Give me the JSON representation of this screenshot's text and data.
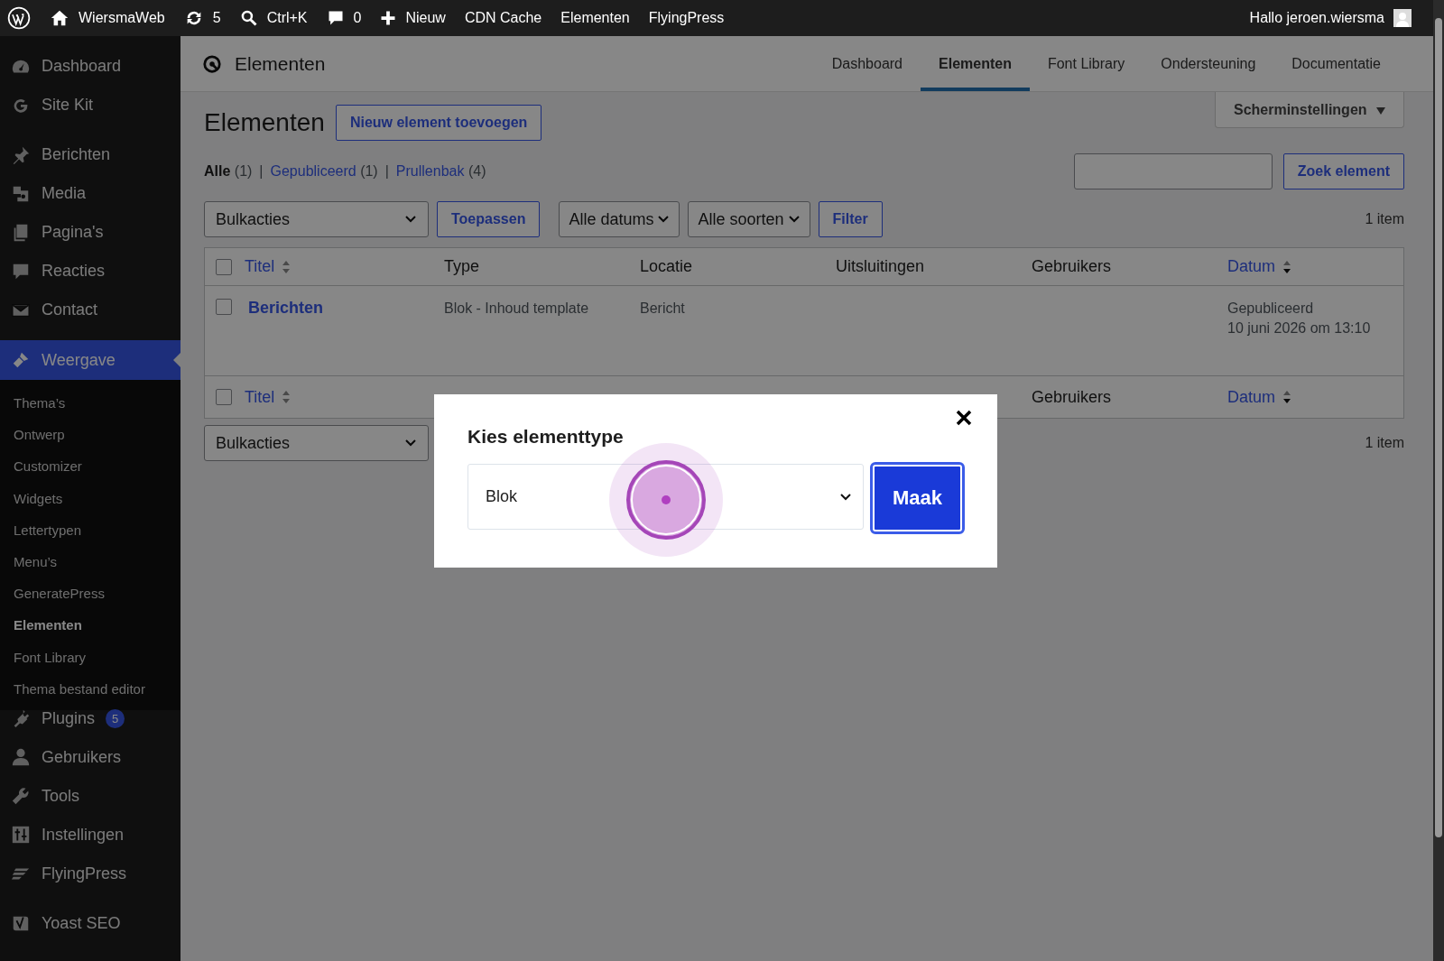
{
  "admin_bar": {
    "items": [
      {
        "kind": "wp-logo"
      },
      {
        "kind": "home",
        "label": "WiersmaWeb"
      },
      {
        "kind": "updates",
        "label": "5"
      },
      {
        "kind": "search",
        "label": "Ctrl+K"
      },
      {
        "kind": "comments",
        "label": "0"
      },
      {
        "kind": "new",
        "label": "Nieuw"
      },
      {
        "kind": "text",
        "label": "CDN Cache"
      },
      {
        "kind": "text",
        "label": "Elementen"
      },
      {
        "kind": "text",
        "label": "FlyingPress"
      }
    ],
    "greeting": "Hallo jeroen.wiersma"
  },
  "sidebar": {
    "groups": [
      [
        {
          "label": "Dashboard",
          "selected": false
        },
        {
          "label": "Site Kit",
          "selected": false
        }
      ],
      [
        {
          "label": "Berichten",
          "selected": false
        },
        {
          "label": "Media",
          "selected": false
        },
        {
          "label": "Pagina's",
          "selected": false
        },
        {
          "label": "Reacties",
          "selected": false
        },
        {
          "label": "Contact",
          "selected": false
        }
      ],
      [
        {
          "label": "Weergave",
          "selected": true,
          "children": [
            {
              "label": "Thema’s",
              "selected": false
            },
            {
              "label": "Ontwerp",
              "selected": false
            },
            {
              "label": "Customizer",
              "selected": false
            },
            {
              "label": "Widgets",
              "selected": false
            },
            {
              "label": "Lettertypen",
              "selected": false
            },
            {
              "label": "Menu’s",
              "selected": false
            },
            {
              "label": "GeneratePress",
              "selected": false
            },
            {
              "label": "Elementen",
              "selected": true
            },
            {
              "label": "Font Library",
              "selected": false
            },
            {
              "label": "Thema bestand editor",
              "selected": false
            }
          ]
        },
        {
          "label": "Plugins",
          "selected": false,
          "badge": "5"
        },
        {
          "label": "Gebruikers",
          "selected": false
        },
        {
          "label": "Tools",
          "selected": false
        },
        {
          "label": "Instellingen",
          "selected": false
        },
        {
          "label": "FlyingPress",
          "selected": false
        }
      ],
      [
        {
          "label": "Yoast SEO",
          "selected": false
        }
      ]
    ]
  },
  "header": {
    "title": "Elementen",
    "tabs": [
      {
        "label": "Dashboard",
        "selected": false
      },
      {
        "label": "Elementen",
        "selected": true
      },
      {
        "label": "Font Library",
        "selected": false
      },
      {
        "label": "Ondersteuning",
        "selected": false
      },
      {
        "label": "Documentatie",
        "selected": false
      }
    ]
  },
  "page": {
    "title": "Elementen",
    "add_button": "Nieuw element toevoegen",
    "screen_options": "Scherminstellingen",
    "views": [
      {
        "label": "Alle",
        "count": "(1)",
        "selected": true
      },
      {
        "separator": "|",
        "label": "Gepubliceerd",
        "count": "(1)",
        "selected": false
      },
      {
        "separator": "|",
        "label": "Prullenbak",
        "count": "(4)",
        "selected": false
      }
    ],
    "search_button": "Zoek element",
    "bulk_actions": "Bulkacties",
    "apply": "Toepassen",
    "date_filter": "Alle datums",
    "type_filter": "Alle soorten",
    "filter_button": "Filter",
    "item_count": "1 item"
  },
  "table": {
    "select_all_checked": false,
    "columns": [
      {
        "label": "Titel",
        "sortable": true,
        "sorted": false
      },
      {
        "label": "Type",
        "sortable": false
      },
      {
        "label": "Locatie",
        "sortable": false
      },
      {
        "label": "Uitsluitingen",
        "sortable": false
      },
      {
        "label": "Gebruikers",
        "sortable": false
      },
      {
        "label": "Datum",
        "sortable": true,
        "sorted": true
      }
    ],
    "rows": [
      {
        "checked": false,
        "title": "Berichten",
        "type": "Blok - Inhoud template",
        "location": "Bericht",
        "status": "Gepubliceerd",
        "date": "10 juni 2026 om 13:10"
      }
    ],
    "footer_checked": false,
    "footer_columns": [
      {
        "label": "Titel",
        "sortable": true,
        "sorted": false
      },
      {
        "label": "Gebruikers",
        "sortable": false
      },
      {
        "label": "Datum",
        "sortable": true,
        "sorted": true
      }
    ]
  },
  "bottom": {
    "bulk_actions": "Bulkacties",
    "item_count": "1 item"
  },
  "modal": {
    "title": "Kies elementtype",
    "select_value": "Blok",
    "button": "Maak"
  }
}
